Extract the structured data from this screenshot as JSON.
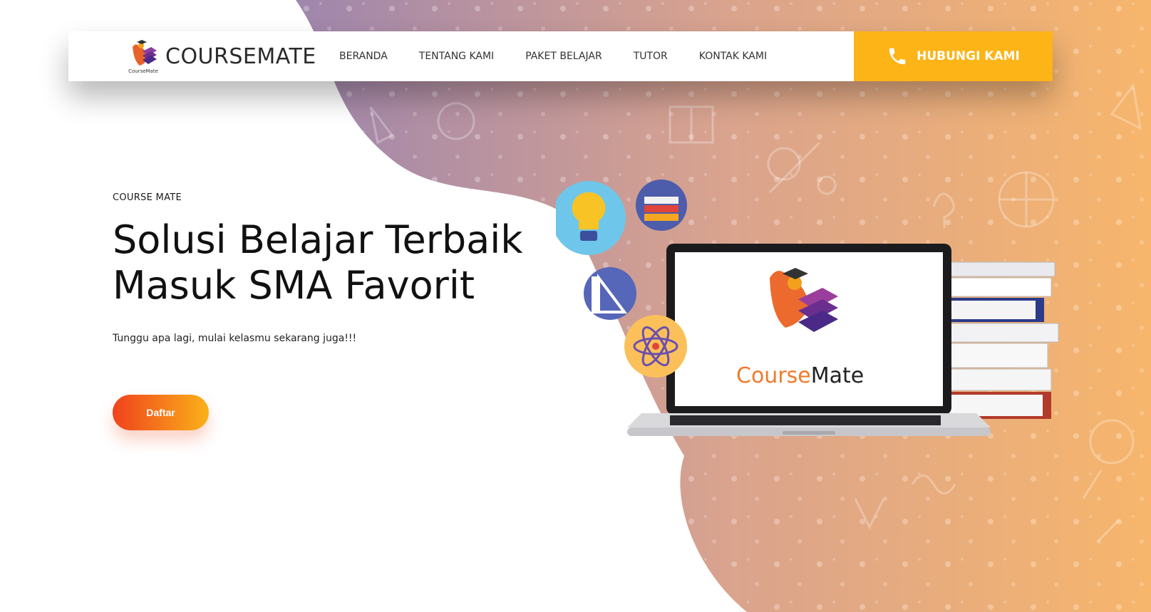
{
  "brand": {
    "name": "COURSEMATE",
    "logo_mini": "CourseMate"
  },
  "nav": {
    "items": [
      "BERANDA",
      "TENTANG KAMI",
      "PAKET BELAJAR",
      "TUTOR",
      "KONTAK KAMI"
    ]
  },
  "cta": {
    "label": "HUBUNGI KAMI",
    "icon": "phone-icon",
    "color": "#fcb417"
  },
  "hero": {
    "eyebrow": "COURSE MATE",
    "headline_line1": "Solusi Belajar Terbaik",
    "headline_line2": "Masuk SMA Favorit",
    "subtext": "Tunggu apa lagi, mulai kelasmu sekarang juga!!!",
    "button_label": "Daftar"
  },
  "illustration": {
    "screen_brand_part1": "Course",
    "screen_brand_part2": "Mate",
    "icons": [
      "lightbulb-icon",
      "books-icon",
      "ruler-triangle-icon",
      "atom-icon"
    ]
  },
  "colors": {
    "accent_orange": "#f0421c",
    "accent_yellow": "#fcb417",
    "bg_gradient_start": "#a88bb2",
    "bg_gradient_end": "#f7b46e"
  }
}
